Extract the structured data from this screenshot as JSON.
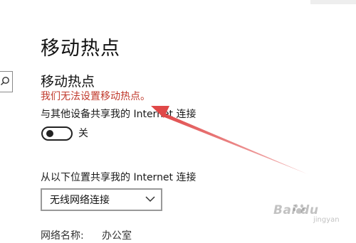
{
  "page": {
    "title": "移动热点"
  },
  "hotspot": {
    "section_title": "移动热点",
    "error_message": "我们无法设置移动热点。",
    "share_label": "与其他设备共享我的 Internet 连接",
    "toggle_state": "关",
    "toggle_on": false
  },
  "share_from": {
    "label": "从以下位置共享我的 Internet 连接",
    "selected": "无线网络连接"
  },
  "network": {
    "name_label": "网络名称:",
    "name_value": "办公室"
  },
  "colors": {
    "error": "#c0392b",
    "arrow": "#e04848",
    "toggle": "#222222",
    "dropdown_border": "#999999"
  },
  "icons": {
    "search": "search-icon",
    "chevron": "chevron-down-icon",
    "arrow": "red-annotation-arrow"
  },
  "watermark": {
    "text": "Bai du",
    "sub": "jingyan"
  }
}
